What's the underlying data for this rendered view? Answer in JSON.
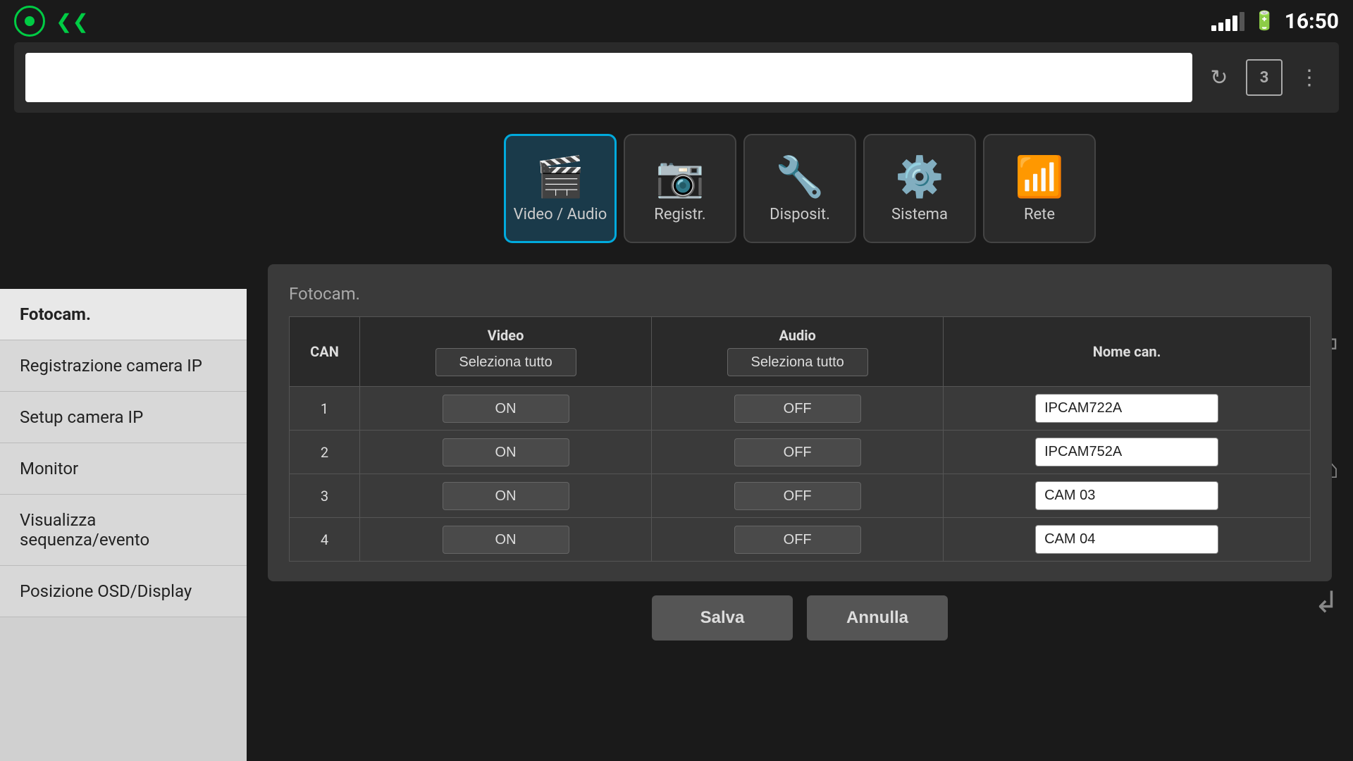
{
  "statusBar": {
    "time": "16:50",
    "signalBars": [
      4,
      8,
      12,
      16,
      20
    ],
    "batteryLabel": "🔋"
  },
  "topNav": [
    {
      "id": "video-audio",
      "label": "Video / Audio",
      "icon": "🎬",
      "active": true
    },
    {
      "id": "registr",
      "label": "Registr.",
      "icon": "📷",
      "active": false
    },
    {
      "id": "disposit",
      "label": "Disposit.",
      "icon": "🔧",
      "active": false
    },
    {
      "id": "sistema",
      "label": "Sistema",
      "icon": "⚙",
      "active": false
    },
    {
      "id": "rete",
      "label": "Rete",
      "icon": "📶",
      "active": false
    }
  ],
  "sidebar": {
    "items": [
      {
        "label": "Fotocam.",
        "active": true
      },
      {
        "label": "Registrazione camera IP",
        "active": false
      },
      {
        "label": "Setup camera IP",
        "active": false
      },
      {
        "label": "Monitor",
        "active": false
      },
      {
        "label": "Visualizza sequenza/evento",
        "active": false
      },
      {
        "label": "Posizione OSD/Display",
        "active": false
      }
    ]
  },
  "tableSection": {
    "title": "Fotocam.",
    "headers": {
      "can": "CAN",
      "video": "Video",
      "audio": "Audio",
      "nomeCan": "Nome can."
    },
    "videoSelectAll": "Seleziona tutto",
    "audioSelectAll": "Seleziona tutto",
    "rows": [
      {
        "can": "1",
        "video": "ON",
        "audio": "OFF",
        "nome": "IPCAM722A"
      },
      {
        "can": "2",
        "video": "ON",
        "audio": "OFF",
        "nome": "IPCAM752A"
      },
      {
        "can": "3",
        "video": "ON",
        "audio": "OFF",
        "nome": "CAM 03"
      },
      {
        "can": "4",
        "video": "ON",
        "audio": "OFF",
        "nome": "CAM 04"
      }
    ]
  },
  "buttons": {
    "save": "Salva",
    "cancel": "Annulla"
  },
  "browserBar": {
    "reload": "↻",
    "tabs": "3",
    "menu": "⋮"
  }
}
